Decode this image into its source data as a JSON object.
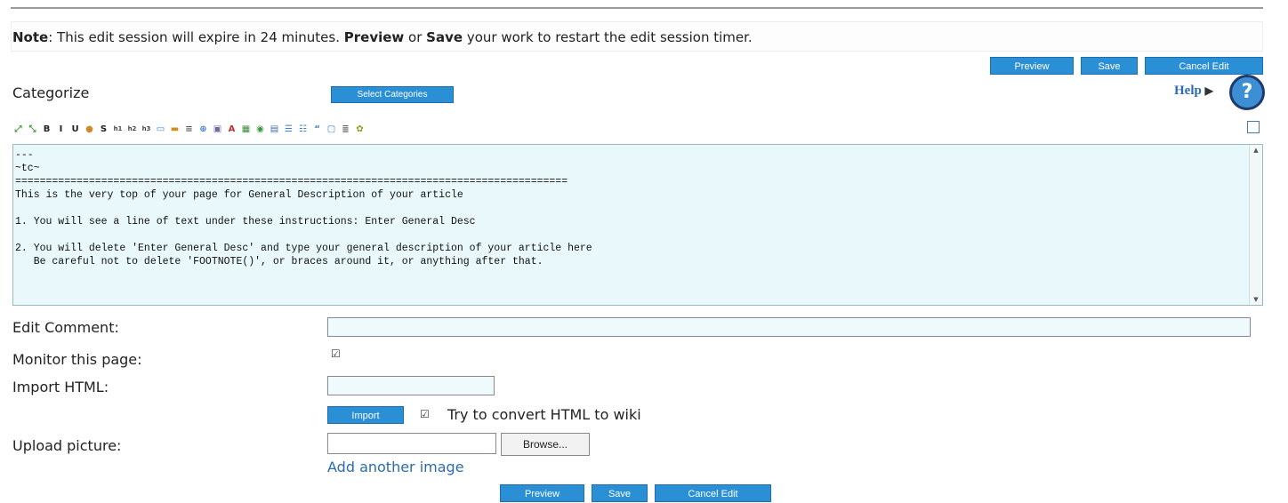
{
  "notice": {
    "prefix": "Note",
    "text_1": ": This edit session will expire in 24 minutes. ",
    "bold_preview": "Preview",
    "text_2": " or ",
    "bold_save": "Save",
    "text_3": " your work to restart the edit session timer."
  },
  "top_actions": {
    "preview": "Preview",
    "save": "Save",
    "cancel": "Cancel Edit"
  },
  "categorize": {
    "label": "Categorize",
    "button": "Select Categories"
  },
  "help": {
    "label": "Help",
    "arrow": "▶",
    "icon": "?"
  },
  "toolbar": {
    "icons": [
      "expand-icon",
      "collapse-icon",
      "bold-icon",
      "italic-icon",
      "underline-icon",
      "color-icon",
      "strikethrough-icon",
      "heading1-icon",
      "heading2-icon",
      "heading3-icon",
      "page-icon",
      "table-icon",
      "center-icon",
      "link-icon",
      "image-icon",
      "pdf-icon",
      "picture-icon",
      "globe-icon",
      "save-icon",
      "bullet-list-icon",
      "numbered-list-icon",
      "quote-icon",
      "box-icon",
      "rule-icon",
      "special-char-icon"
    ],
    "glyphs": [
      "⤢",
      "⤡",
      "B",
      "I",
      "U",
      "●",
      "S",
      "h1",
      "h2",
      "h3",
      "▭",
      "▬",
      "≡",
      "⊕",
      "▣",
      "A",
      "▦",
      "◉",
      "▤",
      "☰",
      "☷",
      "“",
      "▢",
      "≣",
      "✿"
    ],
    "right_icon": "□"
  },
  "editor": {
    "content": "---\n~tc~\n==========================================================================================\nThis is the very top of your page for General Description of your article\n\n1. You will see a line of text under these instructions: Enter General Desc\n\n2. You will delete 'Enter General Desc' and type your general description of your article here\n   Be careful not to delete 'FOOTNOTE()', or braces around it, or anything after that."
  },
  "form": {
    "edit_comment": {
      "label": "Edit Comment:",
      "value": ""
    },
    "monitor": {
      "label": "Monitor this page:",
      "checked": "☑"
    },
    "import_html": {
      "label": "Import HTML:",
      "value": "",
      "button": "Import",
      "convert_label": "Try to convert HTML to wiki",
      "convert_checked": "☑"
    },
    "upload": {
      "label": "Upload picture:",
      "browse": "Browse...",
      "add_link": "Add another image"
    }
  },
  "bottom_actions": {
    "preview": "Preview",
    "save": "Save",
    "cancel": "Cancel Edit"
  }
}
